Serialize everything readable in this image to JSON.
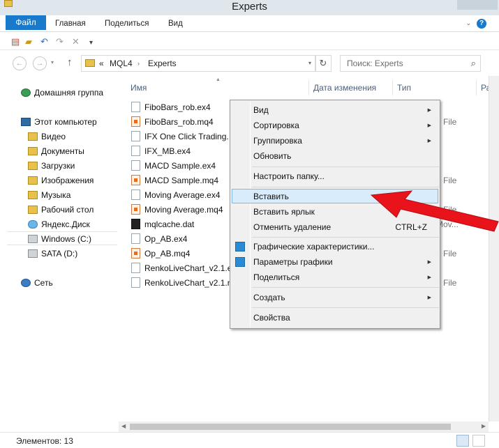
{
  "window": {
    "title": "Experts"
  },
  "ribbon": {
    "tabs": [
      "Файл",
      "Главная",
      "Поделиться",
      "Вид"
    ]
  },
  "address": {
    "prefix": "«",
    "parts": [
      "MQL4",
      "Experts"
    ]
  },
  "search": {
    "placeholder": "Поиск: Experts"
  },
  "nav": {
    "homegroup": "Домашняя группа",
    "computer": "Этот компьютер",
    "items": [
      "Видео",
      "Документы",
      "Загрузки",
      "Изображения",
      "Музыка",
      "Рабочий стол",
      "Яндекс.Диск",
      "Windows (C:)",
      "SATA (D:)"
    ],
    "network": "Сеть"
  },
  "columns": {
    "name": "Имя",
    "date": "Дата изменения",
    "type": "Тип",
    "size": "Ра"
  },
  "files": [
    {
      "name": "FiboBars_rob.ex4",
      "type": ""
    },
    {
      "name": "FiboBars_rob.mq4",
      "type": "e File"
    },
    {
      "name": "IFX One Click Trading.",
      "type": ""
    },
    {
      "name": "IFX_MB.ex4",
      "type": ""
    },
    {
      "name": "MACD Sample.ex4",
      "type": ""
    },
    {
      "name": "MACD Sample.mq4",
      "type": "e File"
    },
    {
      "name": "Moving Average.ex4",
      "type": ""
    },
    {
      "name": "Moving Average.mq4",
      "type": "e File"
    },
    {
      "name": "mqlcache.dat",
      "type": "Mov..."
    },
    {
      "name": "Op_AB.ex4",
      "type": ""
    },
    {
      "name": "Op_AB.mq4",
      "type": "e File"
    },
    {
      "name": "RenkoLiveChart_v2.1.e",
      "type": ""
    },
    {
      "name": "RenkoLiveChart_v2.1.n",
      "type": "e File"
    }
  ],
  "context_menu": {
    "view": "Вид",
    "sort": "Сортировка",
    "group": "Группировка",
    "refresh": "Обновить",
    "customize": "Настроить папку...",
    "paste": "Вставить",
    "paste_shortcut": "Вставить ярлык",
    "undo_delete": "Отменить удаление",
    "undo_shortcut": "CTRL+Z",
    "graphics_props": "Графические характеристики...",
    "graphics_params": "Параметры графики",
    "share": "Поделиться",
    "create": "Создать",
    "properties": "Свойства"
  },
  "status": {
    "count": "Элементов: 13"
  },
  "colors": {
    "accent": "#1979ca",
    "highlight": "#d9ecfb",
    "arrow": "#e8131b"
  }
}
